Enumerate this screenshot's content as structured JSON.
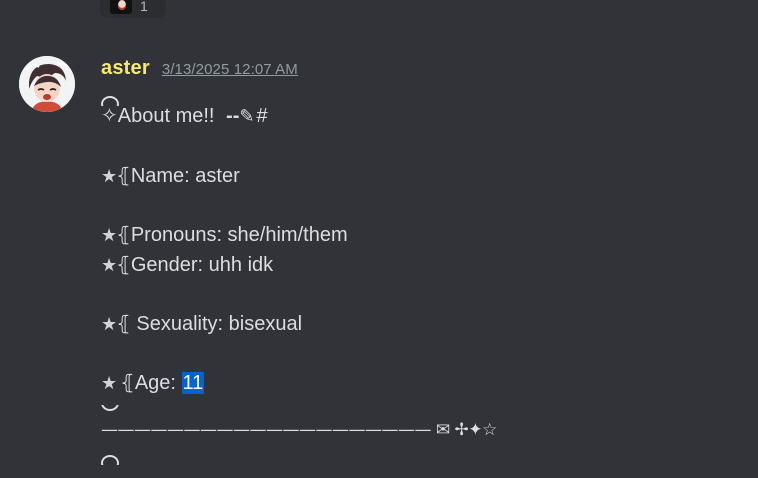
{
  "reaction": {
    "emoji_icon": "anime-face-emoji",
    "count": "1"
  },
  "message": {
    "author": "aster",
    "author_color": "#f6ea6e",
    "timestamp": "3/13/2025 12:07 AM",
    "lines": {
      "about": "✧About me!!",
      "about_suffix": "--",
      "hashtag": "#",
      "name_label": "Name: aster",
      "pronouns_label": "Pronouns: she/him/them",
      "gender_label": "Gender: uhh idk",
      "sexuality_label": " Sexuality: bisexual",
      "age_label": "Age: ",
      "age_value": "11",
      "divider": "———————————————————— ✉ ✢✦☆"
    },
    "bullet_star": "★",
    "bracket_char": "⦃"
  },
  "colors": {
    "background": "#313338",
    "text": "#dbdee1",
    "timestamp": "#949ba4",
    "selection": "#0063d1"
  }
}
